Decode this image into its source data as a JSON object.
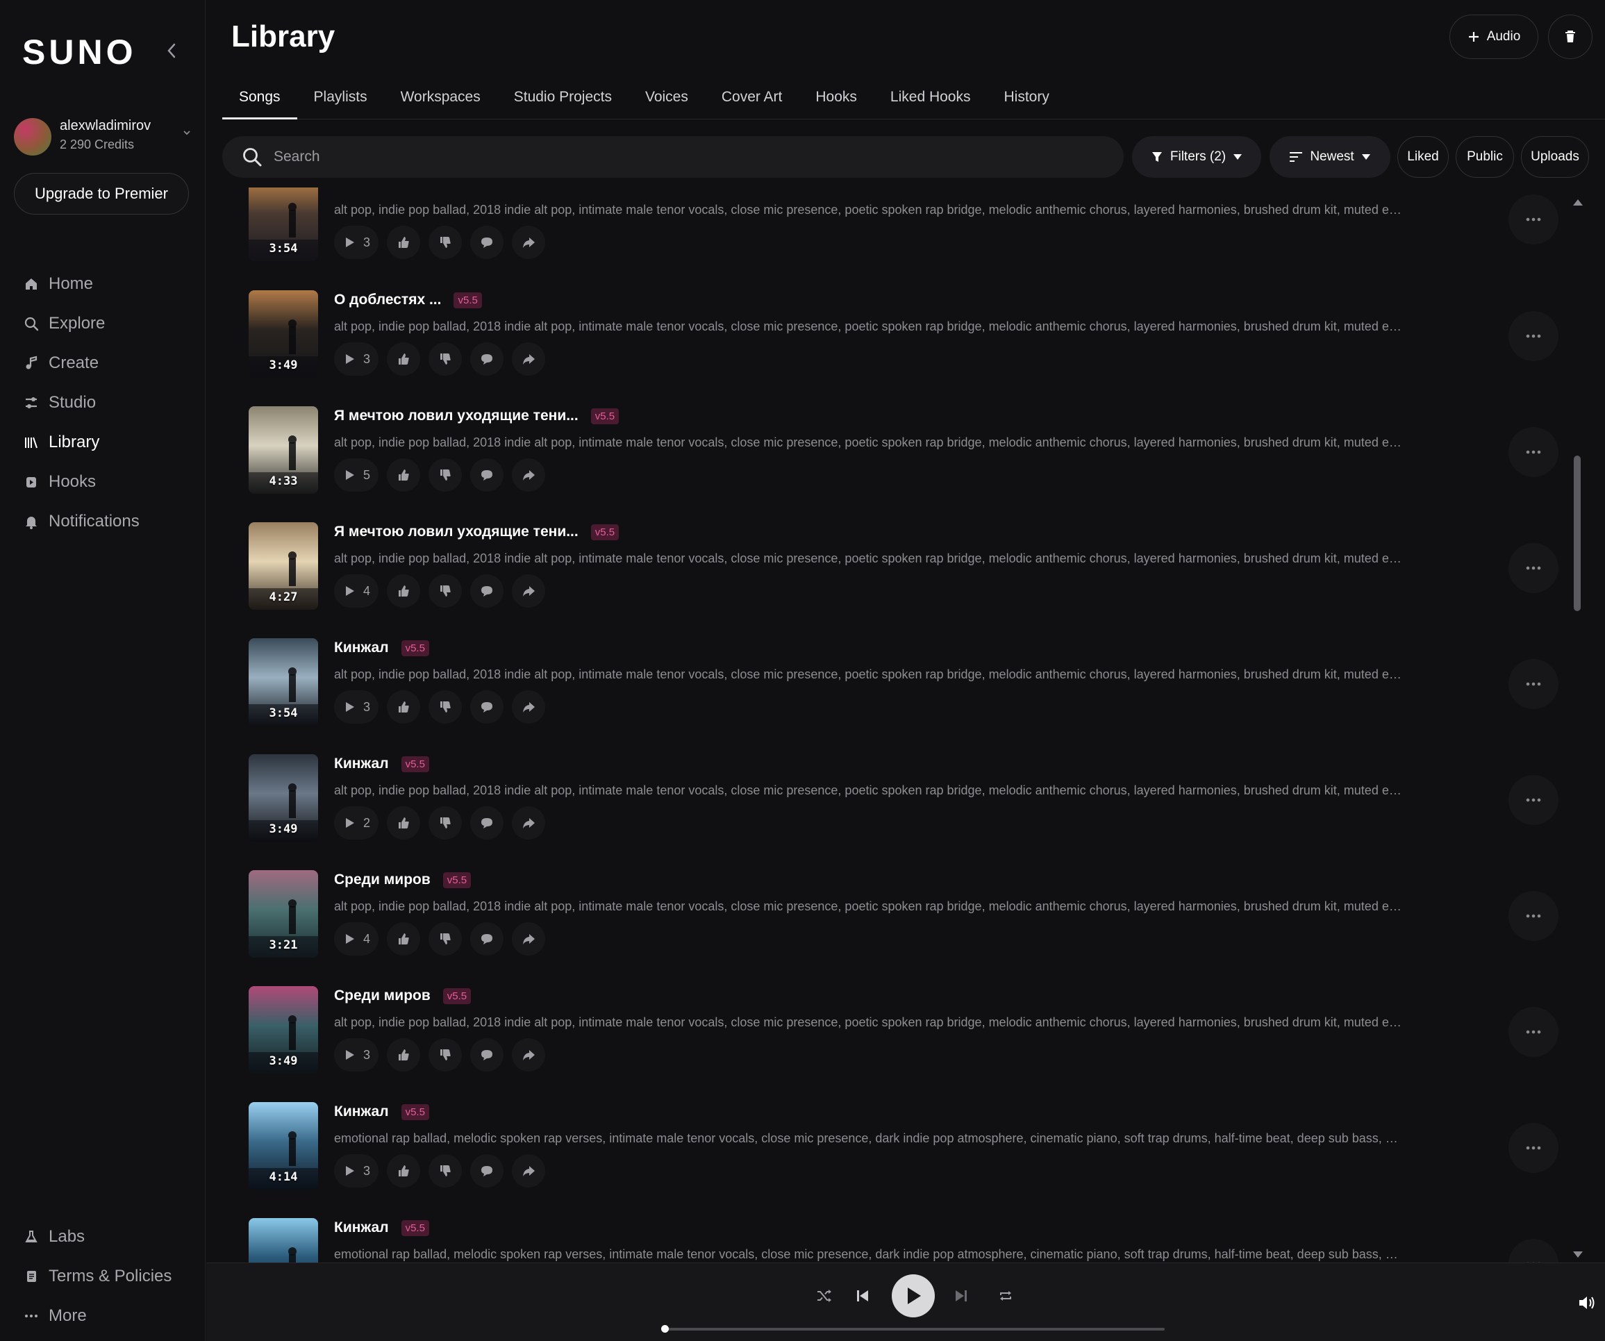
{
  "app": {
    "logo": "SUNO"
  },
  "user": {
    "name": "alexwladimirov",
    "credits": "2 290 Credits"
  },
  "sidebar": {
    "upgrade_label": "Upgrade to Premier",
    "nav": [
      {
        "label": "Home",
        "icon": "home-icon"
      },
      {
        "label": "Explore",
        "icon": "search-icon"
      },
      {
        "label": "Create",
        "icon": "music-note-icon"
      },
      {
        "label": "Studio",
        "icon": "sliders-icon"
      },
      {
        "label": "Library",
        "icon": "library-icon"
      },
      {
        "label": "Hooks",
        "icon": "hook-icon"
      },
      {
        "label": "Notifications",
        "icon": "bell-icon"
      }
    ],
    "bottom": [
      {
        "label": "Labs",
        "icon": "flask-icon"
      },
      {
        "label": "Terms & Policies",
        "icon": "document-icon"
      },
      {
        "label": "More",
        "icon": "ellipsis-icon"
      }
    ]
  },
  "header": {
    "title": "Library",
    "audio_label": "Audio"
  },
  "tabs": [
    "Songs",
    "Playlists",
    "Workspaces",
    "Studio Projects",
    "Voices",
    "Cover Art",
    "Hooks",
    "Liked Hooks",
    "History"
  ],
  "active_tab": "Songs",
  "toolbar": {
    "search_placeholder": "Search",
    "filters_label": "Filters (2)",
    "sort_label": "Newest",
    "liked_label": "Liked",
    "public_label": "Public",
    "uploads_label": "Uploads"
  },
  "songs": [
    {
      "title": "",
      "version": "",
      "tags": "alt pop, indie pop ballad, 2018 indie alt pop, intimate male tenor vocals, close mic presence, poetic spoken rap bridge, melodic anthemic chorus, layered harmonies, brushed drum kit, muted electric ...",
      "plays": "3",
      "duration": "3:54",
      "colors": [
        "#4a3a30",
        "#c98a4a",
        "#1c1c24"
      ]
    },
    {
      "title": "О доблестях ...",
      "version": "v5.5",
      "tags": "alt pop, indie pop ballad, 2018 indie alt pop, intimate male tenor vocals, close mic presence, poetic spoken rap bridge, melodic anthemic chorus, layered harmonies, brushed drum kit, muted electric ...",
      "plays": "3",
      "duration": "3:49",
      "colors": [
        "#2a2420",
        "#b07a48",
        "#15151a"
      ]
    },
    {
      "title": "Я мечтою ловил уходящие тени...",
      "version": "v5.5",
      "tags": "alt pop, indie pop ballad, 2018 indie alt pop, intimate male tenor vocals, close mic presence, poetic spoken rap bridge, melodic anthemic chorus, layered harmonies, brushed drum kit, muted electric ...",
      "plays": "5",
      "duration": "4:33",
      "colors": [
        "#d8d2c0",
        "#8a8470",
        "#2a2a26"
      ]
    },
    {
      "title": "Я мечтою ловил уходящие тени...",
      "version": "v5.5",
      "tags": "alt pop, indie pop ballad, 2018 indie alt pop, intimate male tenor vocals, close mic presence, poetic spoken rap bridge, melodic anthemic chorus, layered harmonies, brushed drum kit, muted electric ...",
      "plays": "4",
      "duration": "4:27",
      "colors": [
        "#e4d4b4",
        "#9a8060",
        "#3a2e22"
      ]
    },
    {
      "title": "Кинжал",
      "version": "v5.5",
      "tags": "alt pop, indie pop ballad, 2018 indie alt pop, intimate male tenor vocals, close mic presence, poetic spoken rap bridge, melodic anthemic chorus, layered harmonies, brushed drum kit, muted electric ...",
      "plays": "3",
      "duration": "3:54",
      "colors": [
        "#9ab0c0",
        "#3a4a58",
        "#14181e"
      ]
    },
    {
      "title": "Кинжал",
      "version": "v5.5",
      "tags": "alt pop, indie pop ballad, 2018 indie alt pop, intimate male tenor vocals, close mic presence, poetic spoken rap bridge, melodic anthemic chorus, layered harmonies, brushed drum kit, muted electric ...",
      "plays": "2",
      "duration": "3:49",
      "colors": [
        "#6a7888",
        "#2c343e",
        "#121418"
      ]
    },
    {
      "title": "Среди миров",
      "version": "v5.5",
      "tags": "alt pop, indie pop ballad, 2018 indie alt pop, intimate male tenor vocals, close mic presence, poetic spoken rap bridge, melodic anthemic chorus, layered harmonies, brushed drum kit, muted electric ...",
      "plays": "4",
      "duration": "3:21",
      "colors": [
        "#4a7070",
        "#a06a80",
        "#1a2a2e"
      ]
    },
    {
      "title": "Среди миров",
      "version": "v5.5",
      "tags": "alt pop, indie pop ballad, 2018 indie alt pop, intimate male tenor vocals, close mic presence, poetic spoken rap bridge, melodic anthemic chorus, layered harmonies, brushed drum kit, muted electric ...",
      "plays": "3",
      "duration": "3:49",
      "colors": [
        "#3a6068",
        "#b04a78",
        "#141e22"
      ]
    },
    {
      "title": "Кинжал",
      "version": "v5.5",
      "tags": "emotional rap ballad, melodic spoken rap verses, intimate male tenor vocals, close mic presence, dark indie pop atmosphere, cinematic piano, soft trap drums, half-time beat, deep sub bass, muted el...",
      "plays": "3",
      "duration": "4:14",
      "colors": [
        "#3a6a8a",
        "#9ad0f0",
        "#0e1a26"
      ]
    },
    {
      "title": "Кинжал",
      "version": "v5.5",
      "tags": "emotional rap ballad, melodic spoken rap verses, intimate male tenor vocals, close mic presence, dark indie pop atmosphere, cinematic piano, soft trap drums, half-time beat, deep sub bass, muted el...",
      "plays": "",
      "duration": "",
      "colors": [
        "#2a5a7a",
        "#8ac8e8",
        "#0c1620"
      ]
    }
  ],
  "player": {
    "progress": 0.0
  }
}
